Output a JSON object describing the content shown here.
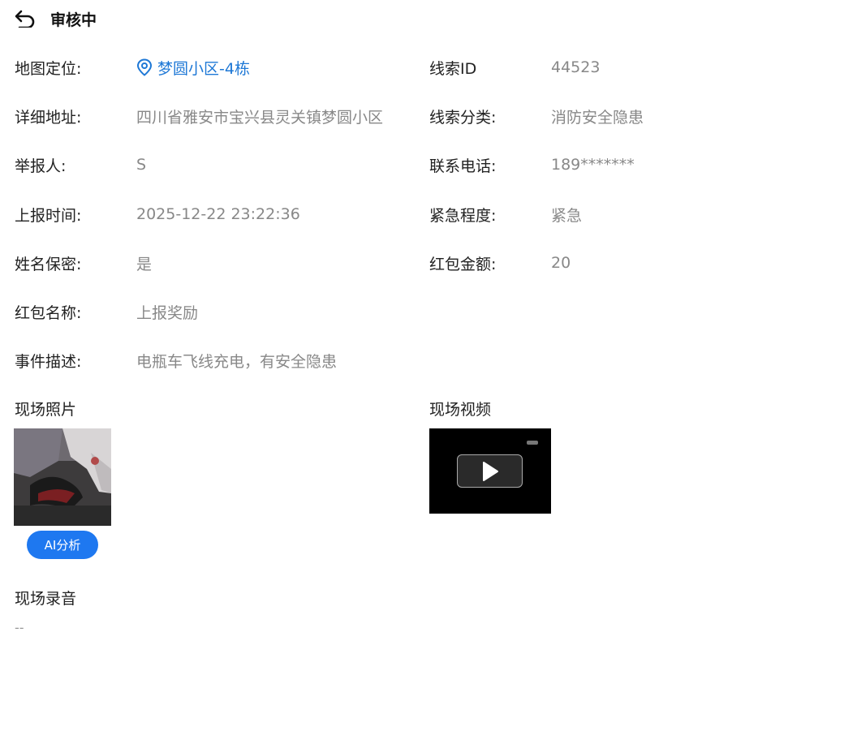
{
  "header": {
    "title": "审核中",
    "back_icon": "back-arrow-icon"
  },
  "fields_left": [
    {
      "label": "地图定位:",
      "value": "梦圆小区-4栋",
      "icon": "location-pin-icon",
      "link_color": "#1e78d6"
    },
    {
      "label": "详细地址:",
      "value": "四川省雅安市宝兴县灵关镇梦圆小区"
    },
    {
      "label": "举报人:",
      "value": "S"
    },
    {
      "label": "上报时间:",
      "value": "2025-12-22 23:22:36"
    },
    {
      "label": "姓名保密:",
      "value": "是"
    },
    {
      "label": "红包名称:",
      "value": "上报奖励"
    },
    {
      "label": "事件描述:",
      "value": "电瓶车飞线充电，有安全隐患"
    }
  ],
  "fields_right": [
    {
      "label": "线索ID",
      "value": "44523"
    },
    {
      "label": "线索分类:",
      "value": "消防安全隐患"
    },
    {
      "label": "联系电话:",
      "value": "189*******"
    },
    {
      "label": "紧急程度:",
      "value": "紧急"
    },
    {
      "label": "红包金额:",
      "value": "20"
    }
  ],
  "media": {
    "photos_title": "现场照片",
    "ai_button": "AI分析",
    "video_title": "现场视频",
    "play_icon": "play-icon",
    "audio_title": "现场录音",
    "audio_empty": "--"
  },
  "colors": {
    "accent": "#1e78f0",
    "link": "#1e78d6",
    "value_text": "#888888"
  }
}
